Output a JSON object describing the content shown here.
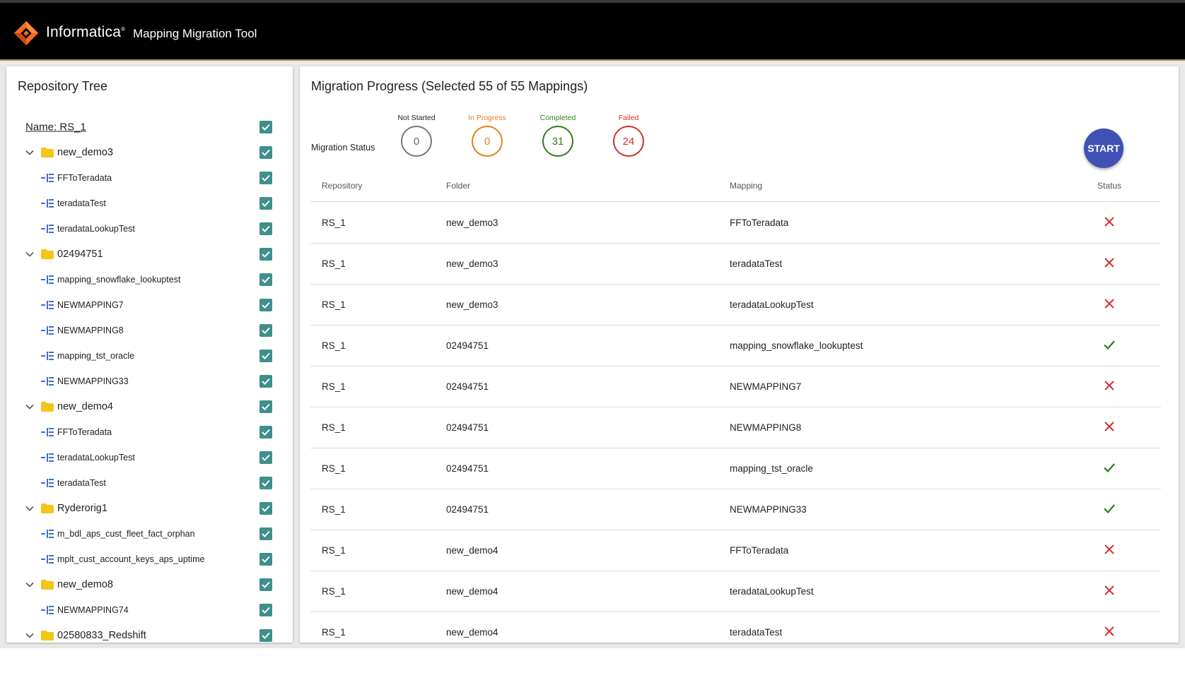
{
  "header": {
    "brand": "Informatica",
    "brand_mark": "®",
    "app_title": "Mapping Migration Tool"
  },
  "colors": {
    "header_bg": "#000000",
    "accent": "#3f51b5",
    "checkbox": "#3f8f8a",
    "not_started": "#777777",
    "in_progress": "#e0821a",
    "completed": "#2e7d1e",
    "failed": "#d32f2f"
  },
  "repo_tree": {
    "title": "Repository Tree",
    "root": {
      "label": "Name: RS_1",
      "checked": true
    },
    "folders": [
      {
        "label": "new_demo3",
        "checked": true,
        "expanded": true,
        "icon": "folder-icon",
        "mappings": [
          {
            "label": "FFToTeradata",
            "checked": true
          },
          {
            "label": "teradataTest",
            "checked": true
          },
          {
            "label": "teradataLookupTest",
            "checked": true
          }
        ]
      },
      {
        "label": "02494751",
        "checked": true,
        "expanded": true,
        "icon": "folder-icon",
        "mappings": [
          {
            "label": "mapping_snowflake_lookuptest",
            "checked": true
          },
          {
            "label": "NEWMAPPING7",
            "checked": true
          },
          {
            "label": "NEWMAPPING8",
            "checked": true
          },
          {
            "label": "mapping_tst_oracle",
            "checked": true
          },
          {
            "label": "NEWMAPPING33",
            "checked": true
          }
        ]
      },
      {
        "label": "new_demo4",
        "checked": true,
        "expanded": true,
        "icon": "folder-icon",
        "mappings": [
          {
            "label": "FFToTeradata",
            "checked": true
          },
          {
            "label": "teradataLookupTest",
            "checked": true
          },
          {
            "label": "teradataTest",
            "checked": true
          }
        ]
      },
      {
        "label": "Ryderorig1",
        "checked": true,
        "expanded": true,
        "icon": "folder-icon",
        "mappings": [
          {
            "label": "m_bdl_aps_cust_fleet_fact_orphan",
            "checked": true
          },
          {
            "label": "mplt_cust_account_keys_aps_uptime",
            "checked": true
          }
        ]
      },
      {
        "label": "new_demo8",
        "checked": true,
        "expanded": true,
        "icon": "folder-icon",
        "mappings": [
          {
            "label": "NEWMAPPING74",
            "checked": true
          }
        ]
      },
      {
        "label": "02580833_Redshift",
        "checked": true,
        "expanded": true,
        "icon": "folder-icon",
        "mappings": []
      }
    ]
  },
  "migration": {
    "title": "Migration Progress (Selected 55 of 55 Mappings)",
    "status_label": "Migration Status",
    "stats": {
      "not_started": {
        "label": "Not Started",
        "value": "0"
      },
      "in_progress": {
        "label": "In Progress",
        "value": "0"
      },
      "completed": {
        "label": "Completed",
        "value": "31"
      },
      "failed": {
        "label": "Failed",
        "value": "24"
      }
    },
    "start_label": "START",
    "columns": {
      "repository": "Repository",
      "folder": "Folder",
      "mapping": "Mapping",
      "status": "Status"
    },
    "rows": [
      {
        "repository": "RS_1",
        "folder": "new_demo3",
        "mapping": "FFToTeradata",
        "status": "failed"
      },
      {
        "repository": "RS_1",
        "folder": "new_demo3",
        "mapping": "teradataTest",
        "status": "failed"
      },
      {
        "repository": "RS_1",
        "folder": "new_demo3",
        "mapping": "teradataLookupTest",
        "status": "failed"
      },
      {
        "repository": "RS_1",
        "folder": "02494751",
        "mapping": "mapping_snowflake_lookuptest",
        "status": "completed"
      },
      {
        "repository": "RS_1",
        "folder": "02494751",
        "mapping": "NEWMAPPING7",
        "status": "failed"
      },
      {
        "repository": "RS_1",
        "folder": "02494751",
        "mapping": "NEWMAPPING8",
        "status": "failed"
      },
      {
        "repository": "RS_1",
        "folder": "02494751",
        "mapping": "mapping_tst_oracle",
        "status": "completed"
      },
      {
        "repository": "RS_1",
        "folder": "02494751",
        "mapping": "NEWMAPPING33",
        "status": "completed"
      },
      {
        "repository": "RS_1",
        "folder": "new_demo4",
        "mapping": "FFToTeradata",
        "status": "failed"
      },
      {
        "repository": "RS_1",
        "folder": "new_demo4",
        "mapping": "teradataLookupTest",
        "status": "failed"
      },
      {
        "repository": "RS_1",
        "folder": "new_demo4",
        "mapping": "teradataTest",
        "status": "failed"
      }
    ]
  }
}
